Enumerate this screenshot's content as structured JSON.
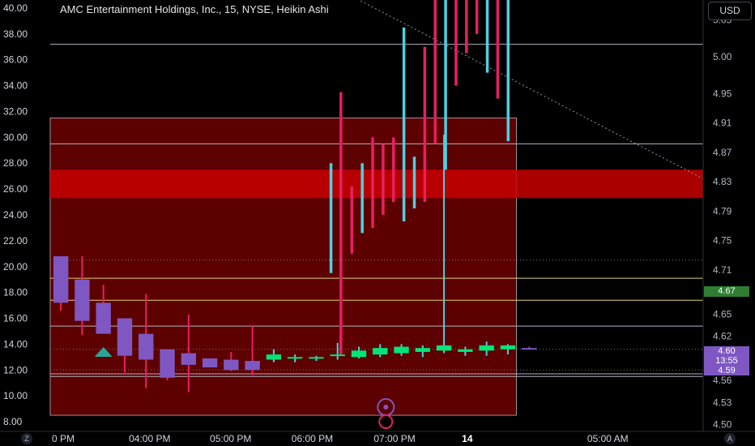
{
  "header": {
    "title": "AMC Entertainment Holdings, Inc., 15, NYSE, Heikin Ashi",
    "currency_button": "USD"
  },
  "footer": {
    "left_button": "Z",
    "right_button": "A"
  },
  "colors": {
    "background": "#000000",
    "bull": "#00e676",
    "bear": "#7e57c2",
    "wick_bull": "#4dd0e1",
    "wick_bear": "#e91e63",
    "zone": "#5c0000",
    "band": "#c80000",
    "label_green": "#2e7d32",
    "label_purple": "#7e57c2"
  },
  "price_tags": {
    "current": "4.67",
    "last": "4.60",
    "countdown": "13:55",
    "low": "4.59"
  },
  "chart_data": {
    "type": "candlestick",
    "title": "AMC Entertainment Holdings, Inc., 15, NYSE, Heikin Ashi",
    "style": "Heikin Ashi",
    "interval": "15",
    "exchange": "NYSE",
    "currency": "USD",
    "x_tick_labels": [
      "0 PM",
      "04:00 PM",
      "05:00 PM",
      "06:00 PM",
      "07:00 PM",
      "14",
      "05:00 AM"
    ],
    "left_axis": {
      "tick_labels": [
        "40.00",
        "38.00",
        "36.00",
        "34.00",
        "32.00",
        "30.00",
        "28.00",
        "26.00",
        "24.00",
        "22.00",
        "20.00",
        "18.00",
        "16.00",
        "14.00",
        "12.00",
        "10.00",
        "8.00"
      ],
      "range": [
        7.5,
        40.5
      ]
    },
    "right_axis": {
      "tick_labels": [
        "5.05",
        "5.00",
        "4.95",
        "4.91",
        "4.87",
        "4.83",
        "4.79",
        "4.75",
        "4.71",
        "4.68",
        "4.65",
        "4.62",
        "4.60",
        "4.56",
        "4.53",
        "4.50"
      ],
      "range": [
        4.495,
        5.075
      ]
    },
    "candles": [
      {
        "open": 20.8,
        "high": 20.8,
        "low": 16.6,
        "close": 17.2,
        "bull": false
      },
      {
        "open": 19.0,
        "high": 20.8,
        "low": 14.7,
        "close": 15.8,
        "bull": false
      },
      {
        "open": 17.2,
        "high": 18.6,
        "low": 14.8,
        "close": 14.8,
        "bull": false
      },
      {
        "open": 16.0,
        "high": 16.0,
        "low": 11.8,
        "close": 13.1,
        "bull": false
      },
      {
        "open": 14.8,
        "high": 17.9,
        "low": 10.6,
        "close": 12.8,
        "bull": false
      },
      {
        "open": 13.6,
        "high": 13.6,
        "low": 11.2,
        "close": 11.4,
        "bull": false
      },
      {
        "open": 13.3,
        "high": 16.3,
        "low": 10.3,
        "close": 12.4,
        "bull": false
      },
      {
        "open": 12.9,
        "high": 12.9,
        "low": 12.2,
        "close": 12.2,
        "bull": false
      },
      {
        "open": 12.8,
        "high": 13.4,
        "low": 11.9,
        "close": 12.0,
        "bull": false
      },
      {
        "open": 12.7,
        "high": 15.4,
        "low": 11.6,
        "close": 12.0,
        "bull": false
      },
      {
        "open": 12.8,
        "high": 13.6,
        "low": 12.6,
        "close": 13.2,
        "bull": true
      },
      {
        "open": 13.0,
        "high": 13.2,
        "low": 12.6,
        "close": 13.0,
        "bull": true
      },
      {
        "open": 13.0,
        "high": 13.1,
        "low": 12.7,
        "close": 13.0,
        "bull": true
      },
      {
        "open": 13.1,
        "high": 14.1,
        "low": 12.8,
        "close": 13.2,
        "bull": true
      },
      {
        "open": 13.0,
        "high": 13.8,
        "low": 12.9,
        "close": 13.5,
        "bull": true
      },
      {
        "open": 13.2,
        "high": 14.0,
        "low": 13.0,
        "close": 13.7,
        "bull": true
      },
      {
        "open": 13.3,
        "high": 14.0,
        "low": 13.1,
        "close": 13.8,
        "bull": true
      },
      {
        "open": 13.4,
        "high": 13.9,
        "low": 13.0,
        "close": 13.7,
        "bull": true
      },
      {
        "open": 13.5,
        "high": 30.2,
        "low": 13.3,
        "close": 13.9,
        "bull": true
      },
      {
        "open": 13.4,
        "high": 13.8,
        "low": 13.1,
        "close": 13.6,
        "bull": true
      },
      {
        "open": 13.5,
        "high": 14.2,
        "low": 13.1,
        "close": 13.9,
        "bull": true
      },
      {
        "open": 13.6,
        "high": 14.0,
        "low": 13.2,
        "close": 13.9,
        "bull": true
      },
      {
        "open": 13.7,
        "high": 13.8,
        "low": 13.6,
        "close": 13.7,
        "bull": false
      }
    ],
    "overlay_ticks": [
      {
        "high": 28.0,
        "low": 19.5,
        "bull": true
      },
      {
        "high": 33.5,
        "low": 13.2,
        "bull": false
      },
      {
        "high": 26.2,
        "low": 21.0,
        "bull": false
      },
      {
        "high": 28.0,
        "low": 22.6,
        "bull": true
      },
      {
        "high": 30.0,
        "low": 23.0,
        "bull": false
      },
      {
        "high": 29.5,
        "low": 24.0,
        "bull": false
      },
      {
        "high": 30.0,
        "low": 25.0,
        "bull": false
      },
      {
        "high": 38.5,
        "low": 23.5,
        "bull": true
      },
      {
        "high": 28.5,
        "low": 24.5,
        "bull": true
      },
      {
        "high": 37.0,
        "low": 25.0,
        "bull": false
      },
      {
        "high": 41.0,
        "low": 29.5,
        "bull": false
      },
      {
        "high": 41.0,
        "low": 27.5,
        "bull": true
      },
      {
        "high": 41.0,
        "low": 34.0,
        "bull": false
      },
      {
        "high": 41.0,
        "low": 36.5,
        "bull": false
      },
      {
        "high": 41.0,
        "low": 38.0,
        "bull": false
      },
      {
        "high": 41.0,
        "low": 35.0,
        "bull": true
      },
      {
        "high": 41.0,
        "low": 33.0,
        "bull": false
      },
      {
        "high": 41.0,
        "low": 29.7,
        "bull": true
      }
    ],
    "zone": {
      "top": 31.5,
      "bottom": 8.5
    },
    "red_band": {
      "top": 27.5,
      "bottom": 25.3
    },
    "horizontal_lines": [
      {
        "price": 40.7,
        "color": "#b2b5be"
      },
      {
        "price": 37.2,
        "color": "#b2b5be"
      },
      {
        "price": 29.5,
        "color": "#b2b5be"
      },
      {
        "price": 19.1,
        "color": "#e6d36a"
      },
      {
        "price": 17.4,
        "color": "#e6d36a"
      },
      {
        "price": 15.4,
        "color": "#b2b5be"
      },
      {
        "price": 11.7,
        "color": "#b2b5be"
      },
      {
        "price": 11.5,
        "color": "#b2b5be"
      }
    ],
    "dotted_lines": [
      20.5,
      13.6,
      12.0
    ],
    "trend_line": {
      "from": [
        0.47,
        40.7
      ],
      "to": [
        1.0,
        26.8
      ]
    },
    "signals": [
      {
        "type": "up-triangle",
        "candle": 2,
        "price": 13.4
      }
    ]
  }
}
